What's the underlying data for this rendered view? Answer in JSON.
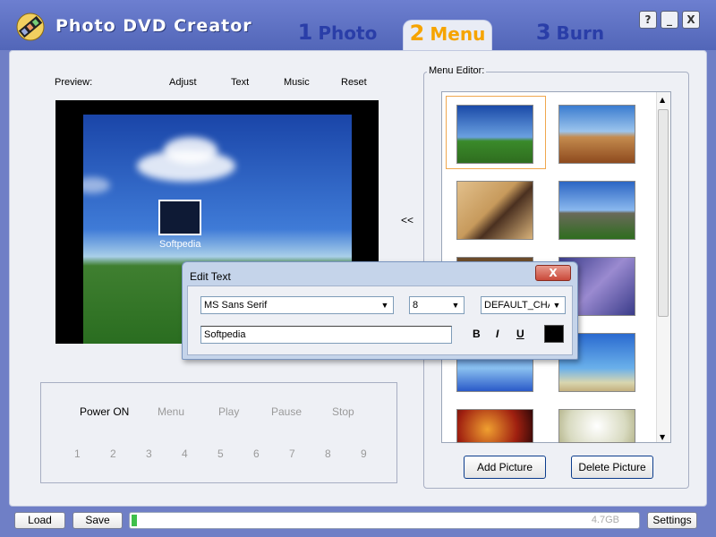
{
  "window": {
    "title": "Photo DVD Creator",
    "buttons": [
      "?",
      "_",
      "X"
    ]
  },
  "tabs": [
    {
      "num": "1",
      "label": "Photo"
    },
    {
      "num": "2",
      "label": "Menu"
    },
    {
      "num": "3",
      "label": "Burn"
    }
  ],
  "preview": {
    "label": "Preview:",
    "menu": [
      "Adjust",
      "Text",
      "Music",
      "Reset"
    ],
    "thumb_label": "Softpedia",
    "move_left": "<<"
  },
  "controls": {
    "row1": [
      "Power ON",
      "Menu",
      "Play",
      "Pause",
      "Stop"
    ],
    "row2": [
      "1",
      "2",
      "3",
      "4",
      "5",
      "6",
      "7",
      "8",
      "9"
    ]
  },
  "menu_editor": {
    "title": "Menu Editor:",
    "add_label": "Add Picture",
    "delete_label": "Delete Picture"
  },
  "dialog": {
    "title": "Edit Text",
    "close": "X",
    "font": "MS Sans Serif",
    "size": "8",
    "charset": "DEFAULT_CHA",
    "text": "Softpedia",
    "bold": "B",
    "italic": "I",
    "underline": "U",
    "text_color": "#000000"
  },
  "bottom": {
    "load": "Load",
    "save": "Save",
    "settings": "Settings",
    "capacity": "4.7GB",
    "progress": 0.01
  },
  "colors": {
    "tab_active": "#f6a400",
    "tab_inactive": "#2a3ea8",
    "progress": "#3fc04a"
  }
}
